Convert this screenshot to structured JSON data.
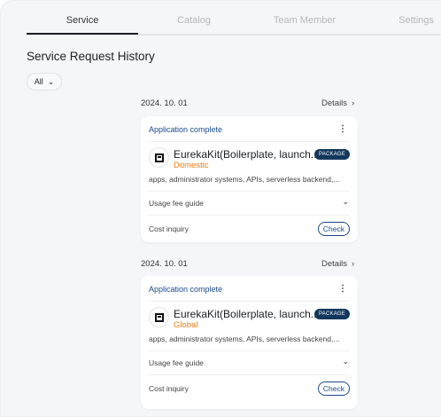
{
  "tabs": [
    {
      "label": "Service"
    },
    {
      "label": "Catalog"
    },
    {
      "label": "Team Member"
    },
    {
      "label": "Settings"
    }
  ],
  "page_title": "Service Request History",
  "filter": {
    "value": "All"
  },
  "requests": [
    {
      "date": "2024. 10. 01",
      "details_label": "Details",
      "status": "Application complete",
      "name": "EurekaKit(Boilerplate, launch...",
      "region": "Domestic",
      "badge": "PACKAGE",
      "description": "apps, administrator systems, APIs, serverless backend,...",
      "fee_label": "Usage fee guide",
      "cost_label": "Cost inquiry",
      "check_label": "Check"
    },
    {
      "date": "2024. 10. 01",
      "details_label": "Details",
      "status": "Application complete",
      "name": "EurekaKit(Boilerplate, launch...",
      "region": "Global",
      "badge": "PACKAGE",
      "description": "apps, administrator systems, APIs, serverless backend,...",
      "fee_label": "Usage fee guide",
      "cost_label": "Cost inquiry",
      "check_label": "Check"
    }
  ]
}
